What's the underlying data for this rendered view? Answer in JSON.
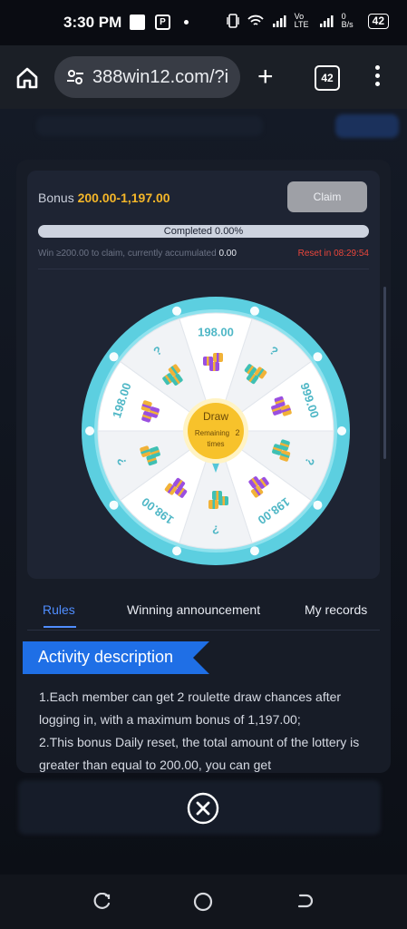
{
  "status_bar": {
    "time": "3:30 PM",
    "net_speed": "0 B/s",
    "volte": "Vo LTE",
    "battery": "42"
  },
  "browser": {
    "url": "388win12.com/?i",
    "tab_count": "42",
    "icons": [
      "home-icon",
      "tune-icon",
      "plus-icon",
      "tabs-icon",
      "more-vert-icon"
    ]
  },
  "bonus_panel": {
    "label": "Bonus",
    "range": "200.00-1,197.00",
    "claim_label": "Claim",
    "progress_text": "Completed 0.00%",
    "progress": 0,
    "hint_text": "Win ≥200.00 to claim, currently accumulated",
    "accumulated": "0.00",
    "reset_text": "Reset in 08:29:54"
  },
  "wheel": {
    "segments": [
      "198.00",
      "?",
      "999.00",
      "?",
      "198.00",
      "?",
      "198.00",
      "?",
      "198.00",
      "?"
    ],
    "center_label": "Draw",
    "remaining_label": "Remaining",
    "remaining_count": "2",
    "times_label": "times",
    "colors": {
      "ring": "#5ccfe0",
      "segment_light": "#ffffff",
      "segment_alt": "#f1f3f6",
      "text": "#4fb7c6",
      "center": "#f7c22b"
    }
  },
  "tabs": [
    {
      "label": "Rules",
      "active": true
    },
    {
      "label": "Winning announcement",
      "active": false
    },
    {
      "label": "My records",
      "active": false
    }
  ],
  "activity": {
    "title": "Activity description",
    "lines": [
      "1.Each member can get 2 roulette draw chances after logging in, with a maximum bonus of 1,197.00;",
      "2.This bonus Daily reset, the total amount of the lottery is greater than equal to 200.00, you can get"
    ]
  },
  "accent_colors": {
    "gold": "#f4b629",
    "blue": "#4f8dff",
    "red": "#e9463b",
    "banner": "#1f6fe6"
  }
}
